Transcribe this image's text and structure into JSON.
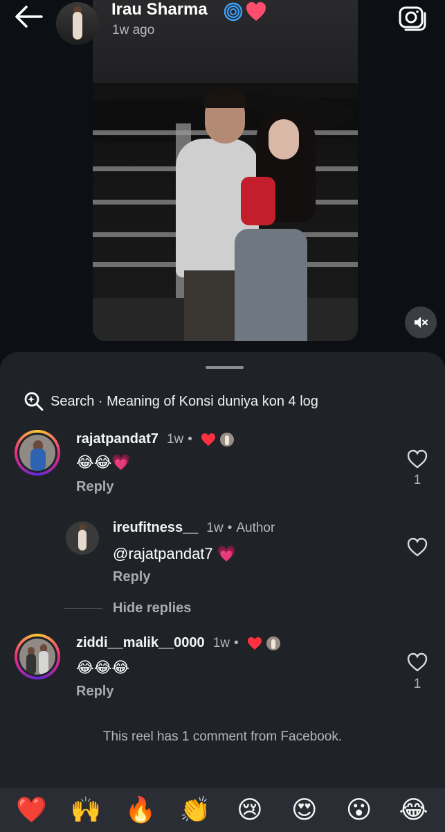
{
  "header": {
    "user_name": "Irau Sharma",
    "time_ago": "1w ago",
    "verified_icon": "fingerprint-verified-icon",
    "title_emoji": "❤️",
    "back_icon": "back-arrow-icon",
    "camera_icon": "camera-icon"
  },
  "video": {
    "mute_icon": "speaker-muted-icon"
  },
  "search": {
    "label": "Search · Meaning of Konsi duniya kon 4 log"
  },
  "comments": [
    {
      "username": "rajatpandat7",
      "time": "1w",
      "dot": "•",
      "text": "😂😂💗",
      "reply_label": "Reply",
      "like_count": "1",
      "author_liked": true
    },
    {
      "username": "ireufitness__",
      "time": "1w",
      "dot": "•",
      "badge": "Author",
      "mention": "@rajatpandat7",
      "text_emoji": "💗",
      "reply_label": "Reply"
    },
    {
      "username": "ziddi__malik__0000",
      "time": "1w",
      "dot": "•",
      "text": "😂😂😂",
      "reply_label": "Reply",
      "like_count": "1",
      "author_liked": true
    }
  ],
  "hide_replies_label": "Hide replies",
  "facebook_note": "This reel has 1 comment from Facebook.",
  "emoji_bar": [
    "❤️",
    "🙌",
    "🔥",
    "👏",
    "😢",
    "😍",
    "😮",
    "😂"
  ],
  "colors": {
    "background": "#0d1117",
    "sheet": "#1f2227",
    "emoji_bar": "#2a2d33",
    "like_heart": "#ff3040",
    "muted_text": "#b5b8be"
  }
}
